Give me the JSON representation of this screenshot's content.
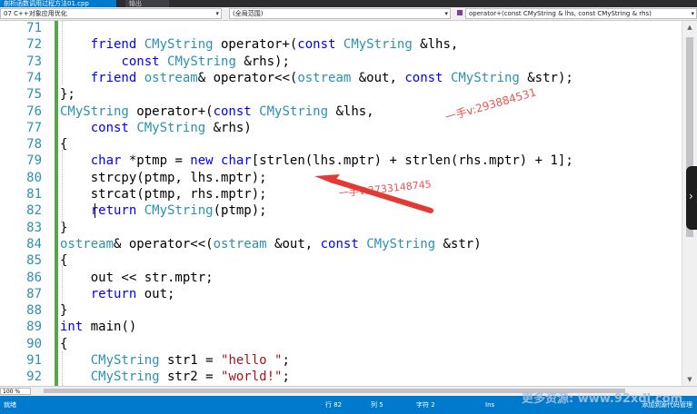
{
  "tabs": {
    "active": "剖析函数调用过程方法01.cpp",
    "other": "输出"
  },
  "nav": {
    "project": "07 C++对象应用优化",
    "scope": "(全局范围)",
    "member": "operator+(const CMyString & lhs, const CMyString & rhs)"
  },
  "code": {
    "line_numbers": [
      "71",
      "72",
      "73",
      "74",
      "75",
      "76",
      "77",
      "78",
      "79",
      "80",
      "81",
      "82",
      "83",
      "84",
      "85",
      "86",
      "87",
      "88",
      "89",
      "90",
      "91",
      "92"
    ],
    "lines": [
      [],
      [
        [
          "    friend ",
          "kw"
        ],
        [
          "CMyString",
          "type"
        ],
        [
          " operator+(",
          "plain"
        ],
        [
          "const",
          "kw"
        ],
        [
          " ",
          "plain"
        ],
        [
          "CMyString",
          "type"
        ],
        [
          " &lhs,",
          "plain"
        ]
      ],
      [
        [
          "        ",
          "plain"
        ],
        [
          "const",
          "kw"
        ],
        [
          " ",
          "plain"
        ],
        [
          "CMyString",
          "type"
        ],
        [
          " &rhs);",
          "plain"
        ]
      ],
      [
        [
          "    friend ",
          "kw"
        ],
        [
          "ostream",
          "type"
        ],
        [
          "& operator<<(",
          "plain"
        ],
        [
          "ostream",
          "type"
        ],
        [
          " &out, ",
          "plain"
        ],
        [
          "const",
          "kw"
        ],
        [
          " ",
          "plain"
        ],
        [
          "CMyString",
          "type"
        ],
        [
          " &str);",
          "plain"
        ]
      ],
      [
        [
          "};",
          "plain"
        ]
      ],
      [
        [
          "CMyString",
          "type"
        ],
        [
          " operator+(",
          "plain"
        ],
        [
          "const",
          "kw"
        ],
        [
          " ",
          "plain"
        ],
        [
          "CMyString",
          "type"
        ],
        [
          " &lhs,",
          "plain"
        ]
      ],
      [
        [
          "    ",
          "plain"
        ],
        [
          "const",
          "kw"
        ],
        [
          " ",
          "plain"
        ],
        [
          "CMyString",
          "type"
        ],
        [
          " &rhs)",
          "plain"
        ]
      ],
      [
        [
          "{",
          "plain"
        ]
      ],
      [
        [
          "    ",
          "plain"
        ],
        [
          "char",
          "kw"
        ],
        [
          " *ptmp = ",
          "plain"
        ],
        [
          "new",
          "kw"
        ],
        [
          " ",
          "plain"
        ],
        [
          "char",
          "kw"
        ],
        [
          "[strlen(lhs.mptr) + strlen(rhs.mptr) + 1];",
          "plain"
        ]
      ],
      [
        [
          "    strcpy(ptmp, lhs.mptr);",
          "plain"
        ]
      ],
      [
        [
          "    strcat(ptmp, rhs.mptr);",
          "plain"
        ]
      ],
      [
        [
          "    ",
          "plain"
        ],
        [
          "return",
          "kw"
        ],
        [
          " ",
          "plain"
        ],
        [
          "CMyString",
          "type"
        ],
        [
          "(ptmp);",
          "plain"
        ]
      ],
      [
        [
          "}",
          "plain"
        ]
      ],
      [
        [
          "ostream",
          "type"
        ],
        [
          "& operator<<(",
          "plain"
        ],
        [
          "ostream",
          "type"
        ],
        [
          " &out, ",
          "plain"
        ],
        [
          "const",
          "kw"
        ],
        [
          " ",
          "plain"
        ],
        [
          "CMyString",
          "type"
        ],
        [
          " &str)",
          "plain"
        ]
      ],
      [
        [
          "{",
          "plain"
        ]
      ],
      [
        [
          "    out << str.mptr;",
          "plain"
        ]
      ],
      [
        [
          "    ",
          "plain"
        ],
        [
          "return",
          "kw"
        ],
        [
          " out;",
          "plain"
        ]
      ],
      [
        [
          "}",
          "plain"
        ]
      ],
      [
        [
          "int",
          "kw"
        ],
        [
          " main()",
          "plain"
        ]
      ],
      [
        [
          "{",
          "plain"
        ]
      ],
      [
        [
          "    ",
          "plain"
        ],
        [
          "CMyString",
          "type"
        ],
        [
          " str1 = ",
          "plain"
        ],
        [
          "\"hello \"",
          "str"
        ],
        [
          ";",
          "plain"
        ]
      ],
      [
        [
          "    ",
          "plain"
        ],
        [
          "CMyString",
          "type"
        ],
        [
          " str2 = ",
          "plain"
        ],
        [
          "\"world!\"",
          "str"
        ],
        [
          ";",
          "plain"
        ]
      ]
    ]
  },
  "annotations": {
    "watermark_1": "一手v:293884531",
    "watermark_2": "一手V:2733148745",
    "site": "更多资源: www.92xdl.com"
  },
  "zoom": "100 %",
  "status": {
    "state": "就绪",
    "row": "行 82",
    "col": "列 5",
    "char": "字符 2",
    "mode": "Ins",
    "source_control": "添加到源代码管理"
  },
  "colors": {
    "keyword": "#0000ff",
    "type": "#2b91af",
    "string": "#a31515",
    "arrow": "#e53935",
    "status_bar": "#007acc",
    "change_bar": "#57a64a"
  }
}
